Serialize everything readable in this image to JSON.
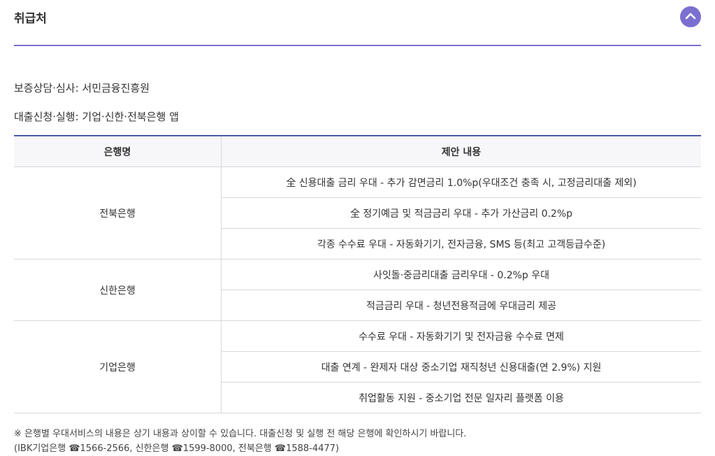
{
  "section": {
    "title": "취급처",
    "toggle_icon": "chevron-up-icon",
    "accent_color": "#7b6fd0"
  },
  "info": {
    "line1": "보증상담·심사: 서민금융진흥원",
    "line2": "대출신청·실행: 기업·신한·전북은행 앱"
  },
  "table": {
    "headers": [
      "은행명",
      "제안 내용"
    ],
    "groups": [
      {
        "bank": "전북은행",
        "items": [
          "全 신용대출 금리 우대 - 추가 감면금리 1.0%p(우대조건 충족 시, 고정금리대출 제외)",
          "全 정기예금 및 적금금리 우대 - 추가 가산금리 0.2%p",
          "각종 수수료 우대 - 자동화기기, 전자금융, SMS 등(최고 고객등급수준)"
        ]
      },
      {
        "bank": "신한은행",
        "items": [
          "사잇돌·중금리대출 금리우대 - 0.2%p 우대",
          "적금금리 우대 - 청년전용적금에 우대금리 제공"
        ]
      },
      {
        "bank": "기업은행",
        "items": [
          "수수료 우대 - 자동화기기 및 전자금융 수수료 면제",
          "대출 연계 - 완제자 대상 중소기업 재직청년 신용대출(연 2.9%) 지원",
          "취업활동 지원 - 중소기업 전문 일자리 플랫폼 이용"
        ]
      }
    ]
  },
  "notes": {
    "line1": "※ 은행별 우대서비스의 내용은 상기 내용과 상이할 수 있습니다. 대출신청 및 실행 전 해당 은행에 확인하시기 바랍니다.",
    "line2": "(IBK기업은행 ☎1566-2566, 신한은행 ☎1599-8000, 전북은행 ☎1588-4477)"
  }
}
